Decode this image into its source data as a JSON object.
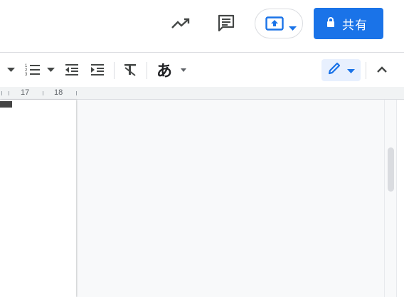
{
  "header": {
    "share_label": "共有",
    "icons": [
      "activity-trend-icon",
      "comment-icon",
      "present-icon",
      "lock-icon"
    ]
  },
  "toolbar": {
    "input_tool_glyph": "あ",
    "icons": [
      "dropdown-arrow-icon",
      "numbered-list-icon",
      "decrease-indent-icon",
      "increase-indent-icon",
      "clear-formatting-icon",
      "editing-mode-pencil-icon",
      "collapse-icon"
    ]
  },
  "ruler": {
    "marks": [
      "17",
      "18"
    ]
  },
  "colors": {
    "accent": "#1a73e8",
    "edit_mode_bg": "#e8f0fe",
    "icon_gray": "#444746"
  }
}
